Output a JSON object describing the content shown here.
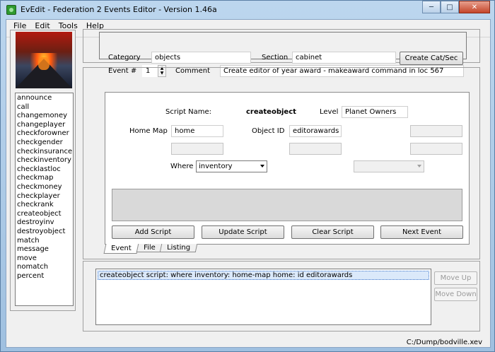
{
  "window": {
    "title": "EvEdit - Federation 2 Events Editor - Version 1.46a"
  },
  "menu": [
    "File",
    "Edit",
    "Tools",
    "Help"
  ],
  "commands": [
    "announce",
    "call",
    "changemoney",
    "changeplayer",
    "checkforowner",
    "checkgender",
    "checkinsurance",
    "checkinventory",
    "checklastloc",
    "checkmap",
    "checkmoney",
    "checkplayer",
    "checkrank",
    "createobject",
    "destroyinv",
    "destroyobject",
    "match",
    "message",
    "move",
    "nomatch",
    "percent"
  ],
  "header": {
    "category_label": "Category",
    "category_value": "objects",
    "section_label": "Section",
    "section_value": "cabinet",
    "create_button": "Create Cat/Sec",
    "event_label": "Event #",
    "event_value": "1",
    "comment_label": "Comment",
    "comment_value": "Create editor of year award - makeaward command in loc 567"
  },
  "editor": {
    "script_name_label": "Script Name:",
    "script_name_value": "createobject",
    "level_label": "Level",
    "level_value": "Planet Owners",
    "home_map_label": "Home Map",
    "home_map_value": "home",
    "object_id_label": "Object ID",
    "object_id_value": "editorawards",
    "where_label": "Where",
    "where_value": "inventory",
    "add_script": "Add Script",
    "update_script": "Update Script",
    "clear_script": "Clear Script",
    "next_event": "Next Event"
  },
  "tabs": [
    "Event",
    "File",
    "Listing"
  ],
  "results": {
    "rows": [
      "createobject script:  where inventory:  home-map home:  id editorawards"
    ],
    "move_up": "Move Up",
    "move_down": "Move Down"
  },
  "status": {
    "path": "C:/Dump/bodville.xev"
  }
}
